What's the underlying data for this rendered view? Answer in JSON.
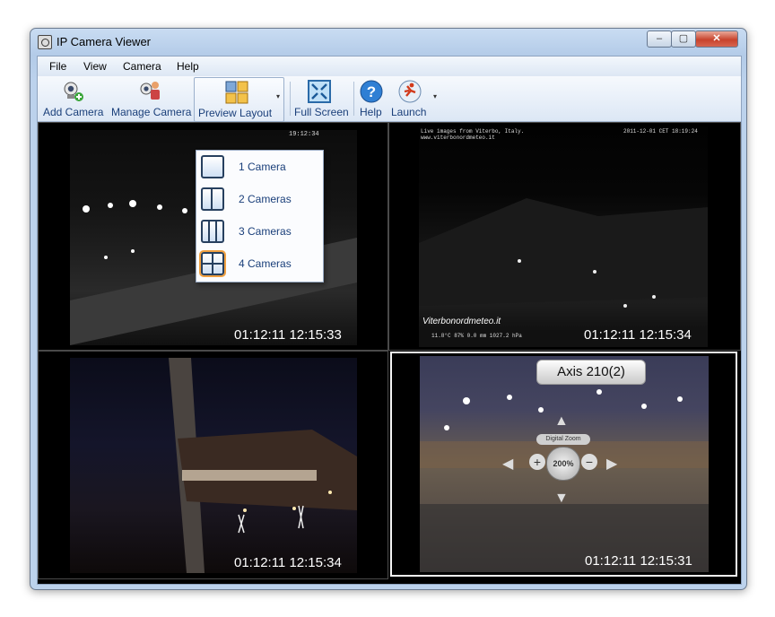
{
  "window": {
    "title": "IP Camera Viewer",
    "minimize": "–",
    "maximize": "▢",
    "close": "✕"
  },
  "menu": [
    "File",
    "View",
    "Camera",
    "Help"
  ],
  "toolbar": {
    "add_camera": "Add Camera",
    "manage_camera": "Manage Camera",
    "preview_layout": "Preview Layout",
    "full_screen": "Full Screen",
    "help": "Help",
    "launch": "Launch"
  },
  "layout_menu": {
    "items": [
      "1 Camera",
      "2 Cameras",
      "3 Cameras",
      "4 Cameras"
    ],
    "selected": "4 Cameras"
  },
  "cameras": [
    {
      "header_left": "",
      "header_right": "19:12:34",
      "timestamp": "01:12:11 12:15:33"
    },
    {
      "header_left": "Live images from Viterbo, Italy.",
      "header_sub": "www.viterbonordmeteo.it",
      "header_right": "2011-12-01 CET 18:19:24",
      "watermark": "Viterbonordmeteo.it",
      "stats": "11.8°C   87%   0.0 mm   1027.2 hPa",
      "timestamp": "01:12:11 12:15:34"
    },
    {
      "timestamp": "01:12:11 12:15:34"
    },
    {
      "ptz_title": "Axis 210(2)",
      "digital_zoom": "Digital Zoom",
      "zoom_level": "200%",
      "timestamp": "01:12:11 12:15:31"
    }
  ],
  "colors": {
    "selected_border": "#f4f4f4",
    "menu_highlight": "#f0a040",
    "toolbar_text": "#1a3f7a"
  }
}
